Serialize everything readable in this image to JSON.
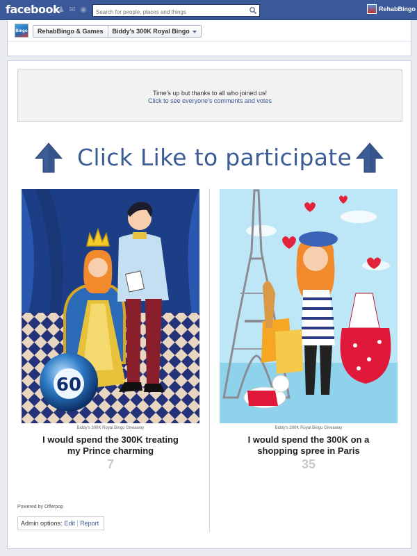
{
  "topbar": {
    "logo": "facebook",
    "search_placeholder": "Search for people, places and things",
    "user_name": "RehabBingo &"
  },
  "page_header": {
    "crumb_page": "RehabBingo & Games",
    "crumb_app": "Biddy's 300K Royal Bingo",
    "avatar_text": "Bingo"
  },
  "notice": {
    "line1": "Time's up but thanks to all who joined us!",
    "line2": "Click to see everyone's comments and votes"
  },
  "cta": {
    "text": "Click Like to participate"
  },
  "entries": [
    {
      "caption": "Biddy's 300K Royal Bingo Giveaway",
      "title": "I would spend the 300K treating my Prince charming",
      "votes": "7",
      "ball_number": "60"
    },
    {
      "caption": "Biddy's 300K Royal Bingo Giveaway",
      "title": "I would spend the 300K on a shopping spree in Paris",
      "votes": "35"
    }
  ],
  "footer": {
    "powered_by": "Powered by Offerpop",
    "admin_label": "Admin options:",
    "edit_label": "Edit",
    "report_label": "Report"
  },
  "colors": {
    "facebook_blue": "#3b5998",
    "cta_blue": "#3b5c95",
    "vote_gray": "#c9c9c9"
  }
}
